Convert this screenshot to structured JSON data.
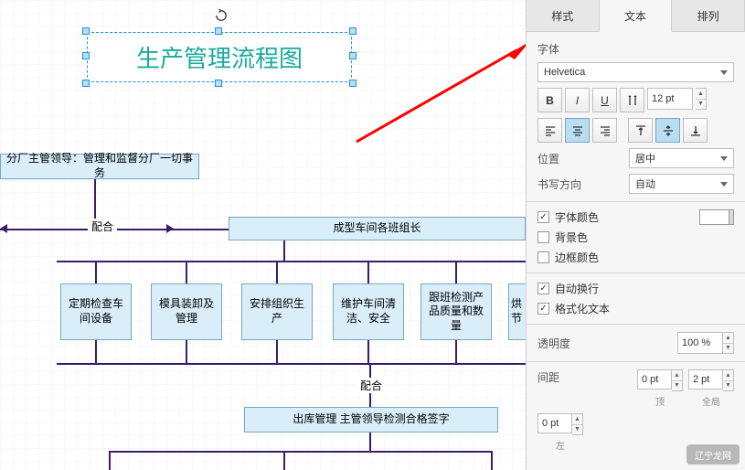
{
  "canvas": {
    "title": "生产管理流程图",
    "manager_box": "分厂主管领导：管理和监督分厂一切事务",
    "coop1": "配合",
    "long_box": "成型车间各班组长",
    "tasks": [
      "定期检查车间设备",
      "模具装卸及管理",
      "安排组织生产",
      "维护车间清洁、安全",
      "跟班检测产品质量和数量",
      "烘 \n节 "
    ],
    "coop2": "配合",
    "bottom_box": "出库管理   主管领导检测合格签字"
  },
  "sidebar": {
    "tabs": [
      "样式",
      "文本",
      "排列"
    ],
    "font_label": "字体",
    "font_value": "Helvetica",
    "size": "12 pt",
    "pos_label": "位置",
    "pos_value": "居中",
    "dir_label": "书写方向",
    "dir_value": "自动",
    "chk_fontcolor": "字体颜色",
    "chk_bgcolor": "背景色",
    "chk_bordercolor": "边框颜色",
    "chk_wrap": "自动换行",
    "chk_format": "格式化文本",
    "opacity_label": "透明度",
    "opacity_value": "100 %",
    "spacing_label": "间距",
    "sp_top": "0 pt",
    "sp_top_lbl": "顶",
    "sp_global": "2 pt",
    "sp_global_lbl": "全局",
    "sp_left": "0 pt",
    "sp_left_lbl": "左"
  },
  "watermark": "辽宁龙网"
}
